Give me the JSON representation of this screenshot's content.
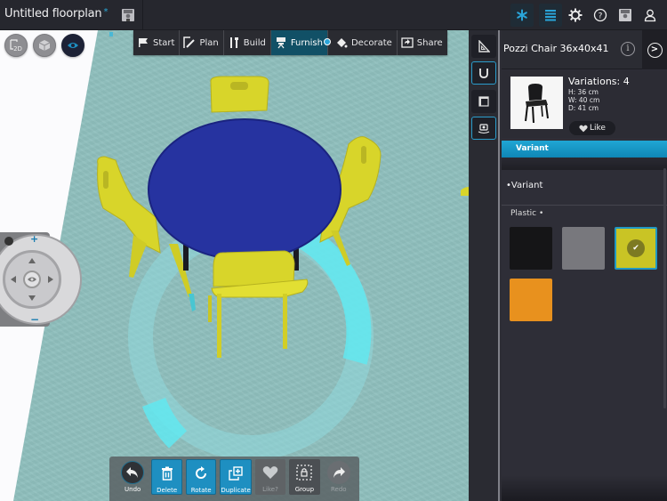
{
  "header": {
    "title": "Untitled floorplan",
    "unsaved_marker": "*",
    "save_icon": "floppy-disk-icon",
    "right_buttons": [
      {
        "name": "snowflake",
        "icon": "asterisk-icon",
        "active": true
      },
      {
        "name": "list",
        "icon": "list-icon",
        "active": true
      },
      {
        "name": "settings",
        "icon": "gear-icon",
        "active": false
      },
      {
        "name": "help",
        "icon": "help-icon",
        "active": false
      },
      {
        "name": "save",
        "icon": "floppy-disk-icon",
        "active": false
      },
      {
        "name": "account",
        "icon": "user-icon",
        "active": false
      }
    ]
  },
  "view_modes": [
    {
      "label": "2D",
      "icon": "2d-icon",
      "active": false
    },
    {
      "label": "3D",
      "icon": "cube-icon",
      "active": false
    },
    {
      "label": "Walk",
      "icon": "eye-icon",
      "active": true
    }
  ],
  "mode_toolbar": [
    {
      "label": "Start",
      "icon": "flag-icon",
      "active": false
    },
    {
      "label": "Plan",
      "icon": "pencil-ruler-icon",
      "active": false
    },
    {
      "label": "Build",
      "icon": "tools-icon",
      "active": false
    },
    {
      "label": "Furnish",
      "icon": "chair-icon",
      "active": true
    },
    {
      "label": "Decorate",
      "icon": "paint-bucket-icon",
      "active": false
    },
    {
      "label": "Share",
      "icon": "share-icon",
      "active": false
    }
  ],
  "joystick": {
    "zoom_in": "+",
    "zoom_out": "−"
  },
  "actions": [
    {
      "label": "Undo",
      "icon": "undo-icon",
      "style": "circle"
    },
    {
      "label": "Delete",
      "icon": "trash-icon",
      "style": "blue"
    },
    {
      "label": "Rotate",
      "icon": "rotate-icon",
      "style": "blue"
    },
    {
      "label": "Duplicate",
      "icon": "duplicate-icon",
      "style": "blue"
    },
    {
      "label": "Like?",
      "icon": "heart-icon",
      "style": "disabled"
    },
    {
      "label": "Group",
      "icon": "group-lock-icon",
      "style": "group"
    },
    {
      "label": "Redo",
      "icon": "redo-icon",
      "style": "redo"
    }
  ],
  "tools": [
    {
      "name": "ruler",
      "icon": "set-square-icon",
      "on": false
    },
    {
      "name": "snap",
      "icon": "magnet-icon",
      "on": true
    },
    {
      "name": "walls",
      "icon": "wall-frame-icon",
      "on": false
    },
    {
      "name": "camera",
      "icon": "camera-icon",
      "on": true
    }
  ],
  "panel": {
    "product_name": "Pozzi Chair 36x40x41",
    "info_icon": "i",
    "next_icon": ">",
    "variations_label": "Variations: 4",
    "height": "H: 36 cm",
    "width": "W: 40 cm",
    "depth": "D: 41 cm",
    "like_label": "Like",
    "tab_label": "Variant",
    "section_label": "Variant",
    "section_prefix": "•",
    "material_label": "Plastic",
    "material_suffix": "•",
    "swatches": [
      {
        "color": "#151517",
        "selected": false
      },
      {
        "color": "#78787d",
        "selected": false
      },
      {
        "color": "#c9c425",
        "selected": true
      },
      {
        "color": "#e8911e",
        "selected": false
      }
    ]
  },
  "scene": {
    "table_color": "#2633a0",
    "chair_color": "#d8d52a",
    "selection_ring_color": "#62e8f0",
    "floor_color": "#8fbfbd"
  }
}
